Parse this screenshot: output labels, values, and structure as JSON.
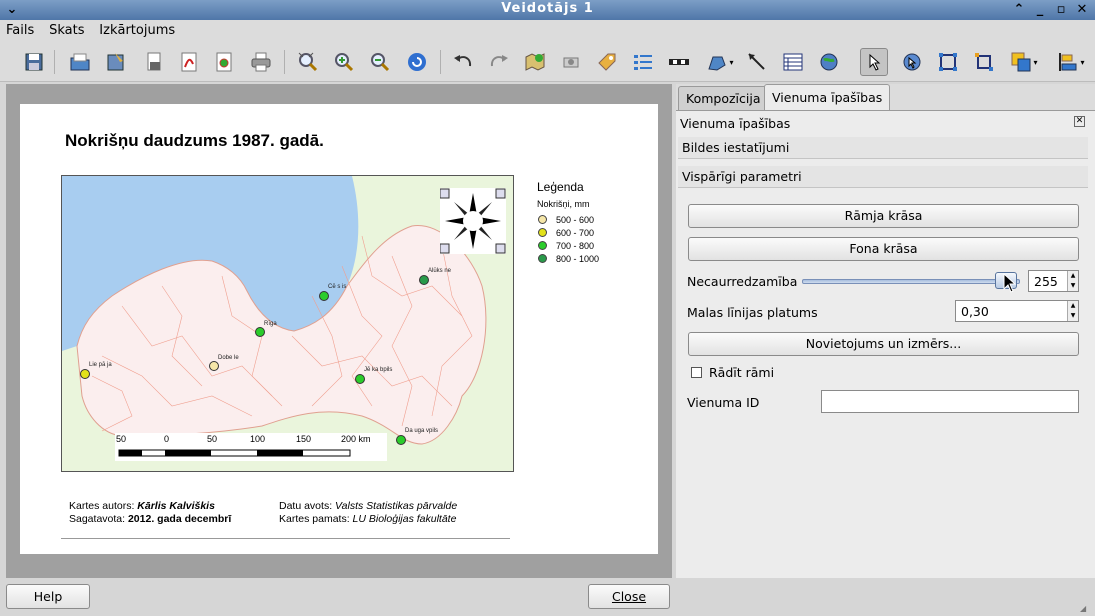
{
  "window": {
    "title": "Veidotājs 1"
  },
  "menu": [
    "Fails",
    "Skats",
    "Izkārtojums"
  ],
  "toolbar": {
    "icons": [
      "save-icon",
      "open-template-icon",
      "save-template-icon",
      "export-image-icon",
      "export-pdf-icon",
      "export-svg-icon",
      "print-icon",
      "zoom-full-icon",
      "zoom-in-icon",
      "zoom-out-icon",
      "refresh-icon",
      "undo-icon",
      "redo-icon",
      "add-map-icon",
      "add-image-icon",
      "add-label-icon",
      "add-legend-icon",
      "add-scalebar-icon",
      "add-shape-icon",
      "add-arrow-icon",
      "add-table-icon",
      "add-html-icon",
      "select-move-icon",
      "move-content-icon",
      "group-icon",
      "ungroup-icon",
      "raise-icon",
      "align-icon"
    ]
  },
  "composer": {
    "map_title": "Nokrišņu daudzums 1987. gadā.",
    "legend": {
      "title": "Leģenda",
      "subtitle": "Nokrišņi, mm",
      "items": [
        {
          "label": "500 - 600",
          "color": "#f5e6a8"
        },
        {
          "label": "600 - 700",
          "color": "#e3e21a"
        },
        {
          "label": "700 - 800",
          "color": "#2bcc2b"
        },
        {
          "label": "800 - 1000",
          "color": "#2a9a4a"
        }
      ]
    },
    "cities": [
      {
        "name": "Alūks ne",
        "color": "#2a9a4a"
      },
      {
        "name": "Cē s is",
        "color": "#2bcc2b"
      },
      {
        "name": "Rīga",
        "color": "#2bcc2b"
      },
      {
        "name": "Dobe le",
        "color": "#f5e6a8"
      },
      {
        "name": "Lie pā ja",
        "color": "#e3e21a"
      },
      {
        "name": "Jē ka bpils",
        "color": "#2bcc2b"
      },
      {
        "name": "Da uga vpils",
        "color": "#2bcc2b"
      }
    ],
    "scale_labels": [
      "50",
      "0",
      "50",
      "100",
      "150",
      "200 km"
    ],
    "credits": {
      "author_label": "Kartes autors:",
      "author": "Kārlis Kalviškis",
      "prepared_label": "Sagatavota:",
      "prepared": "2012. gada decembrī",
      "source_label": "Datu avots:",
      "source": "Valsts Statistikas pārvalde",
      "base_label": "Kartes pamats:",
      "base": "LU Bioloģijas fakultāte"
    },
    "colors": {
      "sea": "#a8cdf0",
      "land": "#e9f5dc",
      "borders": "#f0a090"
    }
  },
  "panel": {
    "tabs": [
      "Kompozīcija",
      "Vienuma īpašības"
    ],
    "header": "Vienuma īpašības",
    "sections": [
      "Bildes iestatījumi",
      "Vispārīgi parametri"
    ],
    "frame_color_btn": "Rāmja krāsa",
    "bg_color_btn": "Fona krāsa",
    "opacity_label": "Necaurredzamība",
    "opacity_value": "255",
    "outline_label": "Malas līnijas platums",
    "outline_value": "0,30",
    "position_btn": "Novietojums un izmērs...",
    "show_frame_label": "Rādīt rāmi",
    "item_id_label": "Vienuma ID",
    "item_id_value": ""
  },
  "bottom": {
    "help": "Help",
    "close": "Close"
  }
}
